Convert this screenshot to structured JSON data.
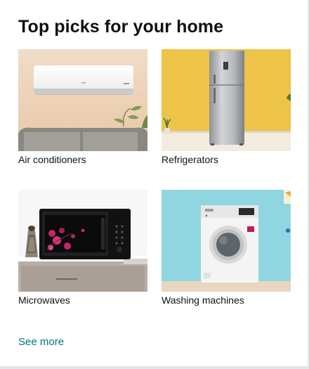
{
  "card": {
    "title": "Top picks for your home",
    "see_more": "See more"
  },
  "tiles": [
    {
      "label": "Air conditioners",
      "image": "air-conditioner-image"
    },
    {
      "label": "Refrigerators",
      "image": "refrigerator-image"
    },
    {
      "label": "Microwaves",
      "image": "microwave-image"
    },
    {
      "label": "Washing machines",
      "image": "washing-machine-image"
    }
  ],
  "colors": {
    "link": "#007185",
    "text": "#0f1111",
    "page_background": "#e3e6e6"
  }
}
